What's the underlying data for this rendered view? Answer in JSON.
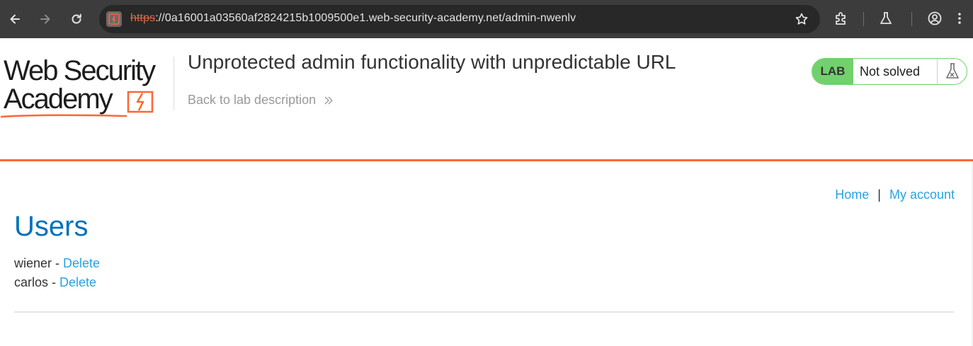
{
  "browser": {
    "url_scheme": "https",
    "url_rest": "://0a16001a03560af2824215b1009500e1.web-security-academy.net/admin-nwenlv",
    "icons": [
      "back-icon",
      "forward-icon",
      "reload-icon",
      "site-info-icon",
      "star-icon",
      "extensions-icon",
      "labs-icon",
      "profile-icon",
      "more-menu-icon"
    ]
  },
  "logo": {
    "line1": "Web Security",
    "line2": "Academy"
  },
  "lab": {
    "title": "Unprotected admin functionality with unpredictable URL",
    "back_link": "Back to lab description",
    "badge": "LAB",
    "status": "Not solved"
  },
  "nav": {
    "home": "Home",
    "separator": "|",
    "my_account": "My account"
  },
  "main": {
    "heading": "Users",
    "users": [
      {
        "name": "wiener",
        "sep": " - ",
        "action": "Delete"
      },
      {
        "name": "carlos",
        "sep": " - ",
        "action": "Delete"
      }
    ]
  },
  "colors": {
    "accent_orange": "#ff6633",
    "link_blue": "#29a3e0",
    "heading_blue": "#0071bc",
    "lab_green": "#70d16d",
    "chrome_dark": "#3c3c3c"
  }
}
